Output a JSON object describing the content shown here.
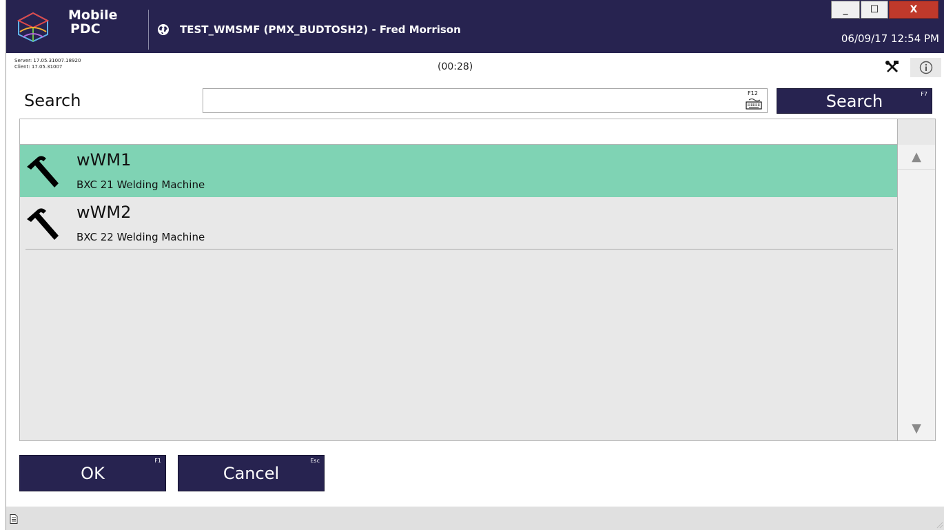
{
  "app": {
    "name_line1": "Mobile",
    "name_line2": "PDC",
    "session_title": "TEST_WMSMF (PMX_BUDTOSH2) - Fred Morrison",
    "datetime": "06/09/17 12:54 PM"
  },
  "window_controls": {
    "minimize": "_",
    "maximize": "☐",
    "close": "X"
  },
  "infobar": {
    "server_version": "Server: 17.05.31007.18920",
    "client_version": "Client: 17.05.31007",
    "timer": "(00:28)",
    "tools_icon": "tools-icon",
    "info_icon": "info-icon"
  },
  "search": {
    "label": "Search",
    "value": "",
    "placeholder": "",
    "keyboard_shortcut": "F12",
    "button_label": "Search",
    "button_shortcut": "F7"
  },
  "list": {
    "items": [
      {
        "title": "wWM1",
        "subtitle": "BXC 21 Welding Machine",
        "selected": true,
        "icon": "hammer-icon"
      },
      {
        "title": "wWM2",
        "subtitle": "BXC 22 Welding Machine",
        "selected": false,
        "icon": "hammer-icon"
      }
    ]
  },
  "actions": {
    "ok_label": "OK",
    "ok_shortcut": "F1",
    "cancel_label": "Cancel",
    "cancel_shortcut": "Esc"
  },
  "colors": {
    "header_bg": "#272350",
    "button_bg": "#272350",
    "selected_row": "#7fd3b4",
    "list_bg": "#e8e8e8"
  }
}
